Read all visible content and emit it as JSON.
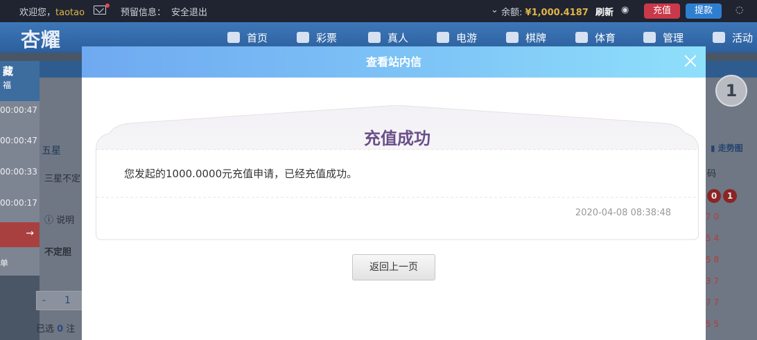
{
  "topbar": {
    "welcome": "欢迎您，",
    "username": "taotao",
    "notice_label": "预留信息：",
    "logout": "安全退出",
    "balance_label": "余额:",
    "balance_value": "¥1,000.4187",
    "refresh": "刷新",
    "recharge": "充值",
    "withdraw": "提款"
  },
  "nav": {
    "logo": "杏耀",
    "items": [
      "首页",
      "彩票",
      "真人",
      "电游",
      "棋牌",
      "体育",
      "管理",
      "活动"
    ]
  },
  "background": {
    "left_title": "藏",
    "left_sub": "福",
    "timers": [
      "00:00:47",
      "00:00:47",
      "00:00:33",
      "00:00:17"
    ],
    "left_bottom": "单",
    "tab_five_star": "五星",
    "row_label": "三星不定",
    "info_label": "说明",
    "bet_label": "不定胆",
    "pager_minus": "-",
    "pager_value": "1",
    "selected_prefix": "已选",
    "selected_count": "0",
    "selected_suffix": "注",
    "trend_label": "走势图",
    "code_label": "码",
    "circle_number": "1",
    "balls": [
      "0",
      "1"
    ],
    "red_codes": [
      "7 0",
      "5 4",
      "5 8",
      "3 7",
      "7 7",
      "5 5"
    ]
  },
  "modal": {
    "title": "查看站内信",
    "message_title": "充值成功",
    "message_body": "您发起的1000.0000元充值申请，已经充值成功。",
    "message_date": "2020-04-08 08:38:48",
    "back_button": "返回上一页"
  },
  "colors": {
    "header_gradient_start": "#6fa9f1",
    "header_gradient_end": "#8fe0fb",
    "message_title": "#6a4e8a",
    "recharge_button": "#c9394a",
    "withdraw_button": "#2f7fd1"
  }
}
